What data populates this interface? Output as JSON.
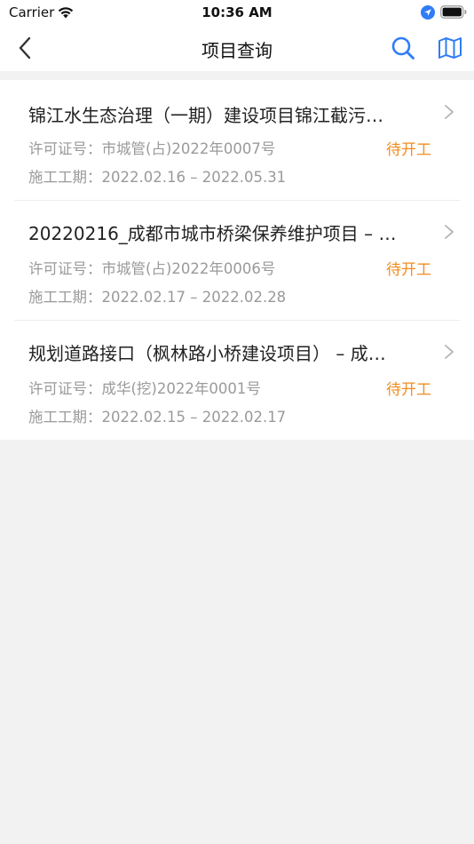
{
  "status_bar": {
    "carrier": "Carrier",
    "time": "10:36 AM",
    "icons": [
      "wifi-icon",
      "location-icon",
      "battery-icon"
    ]
  },
  "nav": {
    "title": "项目查询",
    "back_icon": "chevron-left-icon",
    "search_icon": "search-icon",
    "map_icon": "map-icon"
  },
  "labels": {
    "permit": "许可证号：",
    "period": "施工工期："
  },
  "colors": {
    "accent": "#2f7cf6",
    "status_pending": "#f28c1e",
    "background": "#f2f2f2"
  },
  "projects": [
    {
      "title": "锦江水生态治理（一期）建设项目锦江截污…",
      "permit_no": "市城管(占)2022年0007号",
      "status": "待开工",
      "period": "2022.02.16 – 2022.05.31"
    },
    {
      "title": "20220216_成都市城市桥梁保养维护项目 – …",
      "permit_no": "市城管(占)2022年0006号",
      "status": "待开工",
      "period": "2022.02.17 – 2022.02.28"
    },
    {
      "title": "规划道路接口（枫林路小桥建设项目） – 成…",
      "permit_no": "成华(挖)2022年0001号",
      "status": "待开工",
      "period": "2022.02.15 – 2022.02.17"
    }
  ]
}
